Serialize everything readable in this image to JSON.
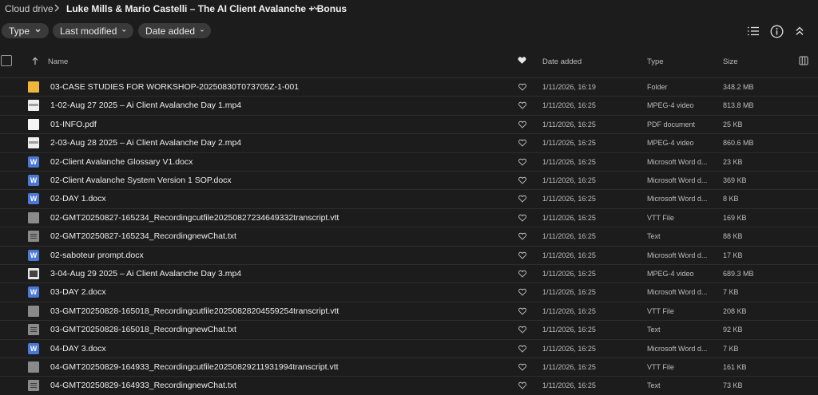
{
  "breadcrumb": {
    "root": "Cloud drive",
    "current": "Luke Mills & Mario Castelli – The AI Client Avalanche + Bonus"
  },
  "filters": [
    {
      "label": "Type"
    },
    {
      "label": "Last modified"
    },
    {
      "label": "Date added"
    }
  ],
  "toolbar_icons": [
    "list-view-icon",
    "info-icon",
    "collapse-icon"
  ],
  "columns": {
    "name": "Name",
    "date_added": "Date added",
    "type": "Type",
    "size": "Size"
  },
  "files": [
    {
      "name": "03-CASE STUDIES FOR WORKSHOP-20250830T073705Z-1-001",
      "date": "1/11/2026, 16:19",
      "type": "Folder",
      "size": "348.2 MB",
      "icon": "folder-icon"
    },
    {
      "name": "1-02-Aug 27 2025 – Ai Client Avalanche Day 1.mp4",
      "date": "1/11/2026, 16:25",
      "type": "MPEG-4 video",
      "size": "813.8 MB",
      "icon": "video-file-icon"
    },
    {
      "name": "01-INFO.pdf",
      "date": "1/11/2026, 16:25",
      "type": "PDF document",
      "size": "25 KB",
      "icon": "pdf-file-icon"
    },
    {
      "name": "2-03-Aug 28 2025 – Ai Client Avalanche Day 2.mp4",
      "date": "1/11/2026, 16:25",
      "type": "MPEG-4 video",
      "size": "860.6 MB",
      "icon": "video-file-icon"
    },
    {
      "name": "02-Client Avalanche Glossary V1.docx",
      "date": "1/11/2026, 16:25",
      "type": "Microsoft Word d...",
      "size": "23 KB",
      "icon": "word-file-icon"
    },
    {
      "name": "02-Client Avalanche System Version 1 SOP.docx",
      "date": "1/11/2026, 16:25",
      "type": "Microsoft Word d...",
      "size": "369 KB",
      "icon": "word-file-icon"
    },
    {
      "name": "02-DAY 1.docx",
      "date": "1/11/2026, 16:25",
      "type": "Microsoft Word d...",
      "size": "8 KB",
      "icon": "word-file-icon"
    },
    {
      "name": "02-GMT20250827-165234_Recordingcutfile20250827234649332transcript.vtt",
      "date": "1/11/2026, 16:25",
      "type": "VTT File",
      "size": "169 KB",
      "icon": "vtt-file-icon"
    },
    {
      "name": "02-GMT20250827-165234_RecordingnewChat.txt",
      "date": "1/11/2026, 16:25",
      "type": "Text",
      "size": "88 KB",
      "icon": "text-file-icon"
    },
    {
      "name": "02-saboteur prompt.docx",
      "date": "1/11/2026, 16:25",
      "type": "Microsoft Word d...",
      "size": "17 KB",
      "icon": "word-file-icon"
    },
    {
      "name": "3-04-Aug 29 2025 – Ai Client Avalanche Day 3.mp4",
      "date": "1/11/2026, 16:25",
      "type": "MPEG-4 video",
      "size": "689.3 MB",
      "icon": "clapper-file-icon"
    },
    {
      "name": "03-DAY 2.docx",
      "date": "1/11/2026, 16:25",
      "type": "Microsoft Word d...",
      "size": "7 KB",
      "icon": "word-file-icon"
    },
    {
      "name": "03-GMT20250828-165018_Recordingcutfile20250828204559254transcript.vtt",
      "date": "1/11/2026, 16:25",
      "type": "VTT File",
      "size": "208 KB",
      "icon": "vtt-file-icon"
    },
    {
      "name": "03-GMT20250828-165018_RecordingnewChat.txt",
      "date": "1/11/2026, 16:25",
      "type": "Text",
      "size": "92 KB",
      "icon": "text-file-icon"
    },
    {
      "name": "04-DAY 3.docx",
      "date": "1/11/2026, 16:25",
      "type": "Microsoft Word d...",
      "size": "7 KB",
      "icon": "word-file-icon"
    },
    {
      "name": "04-GMT20250829-164933_Recordingcutfile20250829211931994transcript.vtt",
      "date": "1/11/2026, 16:25",
      "type": "VTT File",
      "size": "161 KB",
      "icon": "vtt-file-icon"
    },
    {
      "name": "04-GMT20250829-164933_RecordingnewChat.txt",
      "date": "1/11/2026, 16:25",
      "type": "Text",
      "size": "73 KB",
      "icon": "text-file-icon"
    }
  ]
}
